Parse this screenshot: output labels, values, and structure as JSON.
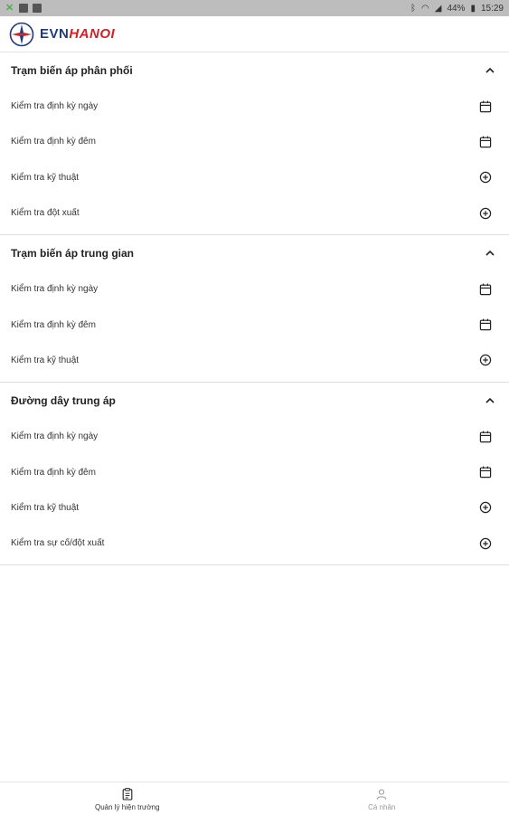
{
  "status_bar": {
    "battery": "44%",
    "time": "15:29"
  },
  "brand": {
    "evn": "EVN",
    "hanoi": "HANOI"
  },
  "colors": {
    "brand_blue": "#1f3b7a",
    "brand_red": "#d32027"
  },
  "sections": [
    {
      "title": "Trạm biến áp phân phối",
      "items": [
        {
          "label": "Kiểm tra định kỳ ngày",
          "icon": "calendar-icon"
        },
        {
          "label": "Kiểm tra định kỳ đêm",
          "icon": "calendar-icon"
        },
        {
          "label": "Kiểm tra kỹ thuật",
          "icon": "add-circle-icon"
        },
        {
          "label": "Kiểm tra đột xuất",
          "icon": "add-circle-icon"
        }
      ]
    },
    {
      "title": "Trạm biến áp trung gian",
      "items": [
        {
          "label": "Kiểm tra định kỳ ngày",
          "icon": "calendar-icon"
        },
        {
          "label": "Kiểm tra định kỳ đêm",
          "icon": "calendar-icon"
        },
        {
          "label": "Kiểm tra kỹ thuật",
          "icon": "add-circle-icon"
        }
      ]
    },
    {
      "title": "Đường dây trung áp",
      "items": [
        {
          "label": "Kiểm tra định kỳ ngày",
          "icon": "calendar-icon"
        },
        {
          "label": "Kiểm tra định kỳ đêm",
          "icon": "calendar-icon"
        },
        {
          "label": "Kiểm tra kỹ thuật",
          "icon": "add-circle-icon"
        },
        {
          "label": "Kiểm tra sự cố/đột xuất",
          "icon": "add-circle-icon"
        }
      ]
    }
  ],
  "bottom_nav": [
    {
      "label": "Quản lý hiện trường",
      "icon": "clipboard-icon",
      "active": true
    },
    {
      "label": "Cá nhân",
      "icon": "person-icon",
      "active": false
    }
  ]
}
